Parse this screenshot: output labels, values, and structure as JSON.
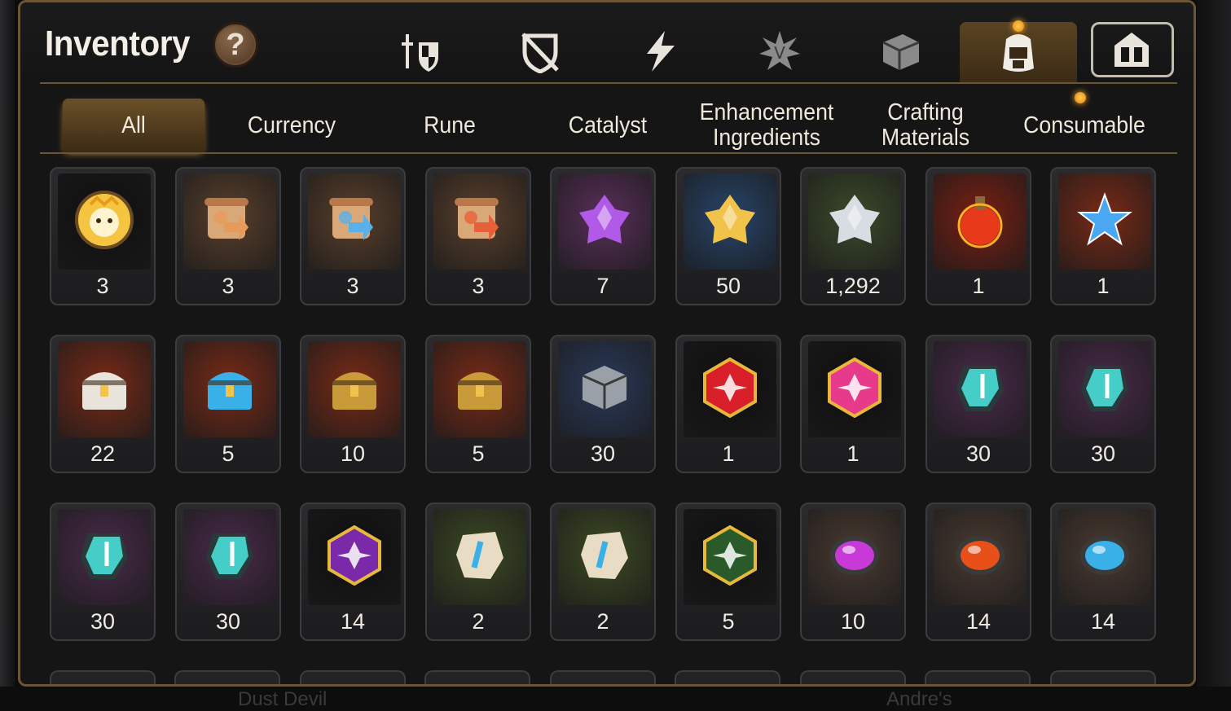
{
  "window": {
    "title": "Inventory",
    "help_label": "?"
  },
  "category_icons": [
    {
      "name": "gear-icon",
      "color": "#e8e4dc"
    },
    {
      "name": "shield-off-icon",
      "color": "#e8e4dc"
    },
    {
      "name": "lightning-icon",
      "color": "#e8e4dc"
    },
    {
      "name": "starburst-icon",
      "color": "#8a8a8a"
    },
    {
      "name": "box-icon",
      "color": "#8a8a8a"
    },
    {
      "name": "backpack-icon",
      "color": "#f0ede6"
    },
    {
      "name": "castle-icon",
      "color": "#e8e4dc"
    }
  ],
  "tabs": [
    {
      "label": "All",
      "active": true
    },
    {
      "label": "Currency",
      "active": false
    },
    {
      "label": "Rune",
      "active": false
    },
    {
      "label": "Catalyst",
      "active": false
    },
    {
      "label": "Enhancement\nIngredients",
      "active": false
    },
    {
      "label": "Crafting\nMaterials",
      "active": false
    },
    {
      "label": "Consumable",
      "active": false
    }
  ],
  "items": [
    {
      "name": "hero-token",
      "count": "3",
      "bg": "#0f0f10",
      "art": "circle-portrait",
      "color": "#f5c542"
    },
    {
      "name": "scroll-dragon",
      "count": "3",
      "bg": "#5a3f2a",
      "art": "scroll",
      "color": "#e89a5a"
    },
    {
      "name": "scroll-rainbow",
      "count": "3",
      "bg": "#5a3f2a",
      "art": "scroll",
      "color": "#5ab0e8"
    },
    {
      "name": "scroll-red",
      "count": "3",
      "bg": "#5a3f2a",
      "art": "scroll",
      "color": "#e8603a"
    },
    {
      "name": "purple-crystal",
      "count": "7",
      "bg": "#5a2f5a",
      "art": "crystal",
      "color": "#b25ae8"
    },
    {
      "name": "gold-crystal",
      "count": "50",
      "bg": "#27456a",
      "art": "crystal",
      "color": "#f2c34a"
    },
    {
      "name": "silver-crystal",
      "count": "1,292",
      "bg": "#3c4a2a",
      "art": "crystal",
      "color": "#d8dde4"
    },
    {
      "name": "red-potion",
      "count": "1",
      "bg": "#7a1f12",
      "art": "potion",
      "color": "#e83a1a"
    },
    {
      "name": "star-potion",
      "count": "1",
      "bg": "#7a2a16",
      "art": "star",
      "color": "#4aa8f2"
    },
    {
      "name": "white-chest",
      "count": "22",
      "bg": "#7a2a16",
      "art": "chest",
      "color": "#e8e4dc"
    },
    {
      "name": "blue-chest",
      "count": "5",
      "bg": "#7a2a16",
      "art": "chest",
      "color": "#3ab0e8"
    },
    {
      "name": "black-chest",
      "count": "10",
      "bg": "#7a2a16",
      "art": "chest",
      "color": "#c89a3a"
    },
    {
      "name": "black-chest-2",
      "count": "5",
      "bg": "#7a2a16",
      "art": "chest",
      "color": "#c89a3a"
    },
    {
      "name": "stone-cube",
      "count": "30",
      "bg": "#2a3a5a",
      "art": "cube",
      "color": "#9aa0a8"
    },
    {
      "name": "red-rune-hex",
      "count": "1",
      "bg": "#0f0f10",
      "art": "hex",
      "color": "#d81f2a"
    },
    {
      "name": "pink-potion-hex",
      "count": "1",
      "bg": "#0f0f10",
      "art": "hex",
      "color": "#e83a8a"
    },
    {
      "name": "sword-rune",
      "count": "30",
      "bg": "#4a2a4a",
      "art": "rune",
      "color": "#4ae8e0"
    },
    {
      "name": "spiral-rune",
      "count": "30",
      "bg": "#4a2a4a",
      "art": "rune",
      "color": "#4ae8e0"
    },
    {
      "name": "armor-rune",
      "count": "30",
      "bg": "#4a2a4a",
      "art": "rune",
      "color": "#4ae8e0"
    },
    {
      "name": "boot-rune",
      "count": "30",
      "bg": "#4a2a4a",
      "art": "rune",
      "color": "#4ae8e0"
    },
    {
      "name": "star-rune-hex",
      "count": "14",
      "bg": "#0f0f10",
      "art": "hex",
      "color": "#7a2aa8"
    },
    {
      "name": "sword-stone",
      "count": "2",
      "bg": "#3c4a22",
      "art": "stone",
      "color": "#3ab0e8"
    },
    {
      "name": "spiral-stone",
      "count": "2",
      "bg": "#3c4a22",
      "art": "stone",
      "color": "#3ab0e8"
    },
    {
      "name": "star-stone-hex",
      "count": "5",
      "bg": "#0f0f10",
      "art": "hex",
      "color": "#2a5a2a"
    },
    {
      "name": "purple-orb",
      "count": "10",
      "bg": "#4a3a30",
      "art": "orb",
      "color": "#c83ad8"
    },
    {
      "name": "red-orb",
      "count": "14",
      "bg": "#4a3a30",
      "art": "orb",
      "color": "#e8501a"
    },
    {
      "name": "blue-orb",
      "count": "14",
      "bg": "#4a3a30",
      "art": "orb",
      "color": "#3ab0e8"
    }
  ],
  "background_text": [
    "Dust Devil",
    "Andre's"
  ],
  "colors": {
    "panel_border": "#6b5534",
    "active_tab": "#6b5028",
    "notification": "#f2a020"
  }
}
